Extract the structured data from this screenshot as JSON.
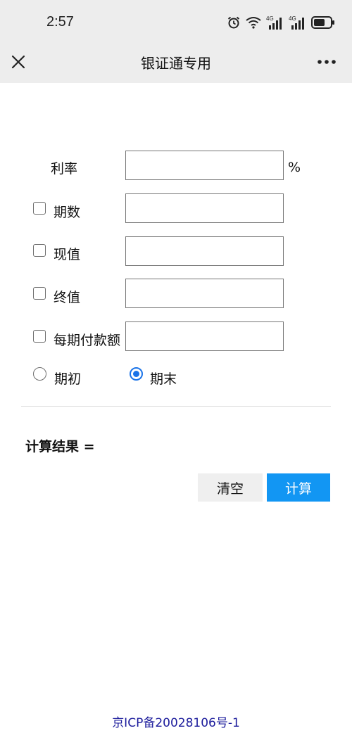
{
  "status_bar": {
    "time": "2:57",
    "icons": [
      "alarm-icon",
      "wifi-icon",
      "signal-4g-icon",
      "signal-4g-icon",
      "battery-icon"
    ],
    "network_label_1": "4G",
    "network_label_2": "4G"
  },
  "navbar": {
    "title": "银证通专用",
    "close_icon": "close-icon",
    "more_icon": "more-icon"
  },
  "form": {
    "rate": {
      "label": "利率",
      "value": "",
      "unit": "%"
    },
    "periods": {
      "label": "期数",
      "value": "",
      "checked": false
    },
    "present_value": {
      "label": "现值",
      "value": "",
      "checked": false
    },
    "future_value": {
      "label": "终值",
      "value": "",
      "checked": false
    },
    "payment": {
      "label": "每期付款额",
      "value": "",
      "checked": false
    },
    "timing": {
      "options": [
        {
          "label": "期初",
          "selected": false
        },
        {
          "label": "期末",
          "selected": true
        }
      ]
    }
  },
  "result": {
    "label": "计算结果 ="
  },
  "buttons": {
    "clear_label": "清空",
    "calculate_label": "计算"
  },
  "footer": {
    "icp": "京ICP备20028106号-1"
  },
  "colors": {
    "accent": "#1296f3",
    "radio_selected": "#1a73e8",
    "bar_bg": "#ededed",
    "footer_link": "#1c1c9c"
  }
}
